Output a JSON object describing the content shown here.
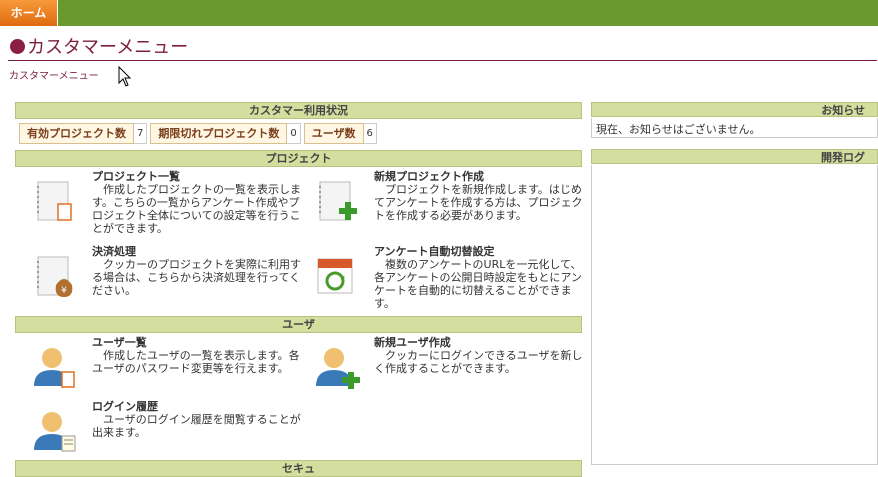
{
  "nav": {
    "home": "ホーム"
  },
  "page_title": "カスタマーメニュー",
  "breadcrumb": "カスタマーメニュー",
  "sections": {
    "usage": "カスタマー利用状況",
    "project": "プロジェクト",
    "user": "ユーザ",
    "next_partial": "セキュ"
  },
  "stats": [
    {
      "label": "有効プロジェクト数",
      "value": "7"
    },
    {
      "label": "期限切れプロジェクト数",
      "value": "0"
    },
    {
      "label": "ユーザ数",
      "value": "6"
    }
  ],
  "project_items": {
    "list": {
      "title": "プロジェクト一覧",
      "desc": "作成したプロジェクトの一覧を表示します。こちらの一覧からアンケート作成やプロジェクト全体についての設定等を行うことができます。",
      "icon": "document-list-icon"
    },
    "new": {
      "title": "新規プロジェクト作成",
      "desc": "プロジェクトを新規作成します。はじめてアンケートを作成する方は、プロジェクトを作成する必要があります。",
      "icon": "document-add-icon"
    },
    "payment": {
      "title": "決済処理",
      "desc": "クッカーのプロジェクトを実際に利用する場合は、こちらから決済処理を行ってください。",
      "icon": "money-bag-icon"
    },
    "auto_switch": {
      "title": "アンケート自動切替設定",
      "desc": "複数のアンケートのURLを一元化して、各アンケートの公開日時設定をもとにアンケートを自動的に切替えることができます。",
      "icon": "calendar-cycle-icon"
    }
  },
  "user_items": {
    "list": {
      "title": "ユーザ一覧",
      "desc": "作成したユーザの一覧を表示します。各ユーザのパスワード変更等を行えます。",
      "icon": "user-list-icon"
    },
    "new": {
      "title": "新規ユーザ作成",
      "desc": "クッカーにログインできるユーザを新しく作成することができます。",
      "icon": "user-add-icon"
    },
    "history": {
      "title": "ログイン履歴",
      "desc": "ユーザのログイン履歴を閲覧することが出来ます。",
      "icon": "user-history-icon"
    }
  },
  "right": {
    "news_title": "お知らせ",
    "news_text": "現在、お知らせはございません。",
    "devlog_title": "開発ログ"
  }
}
